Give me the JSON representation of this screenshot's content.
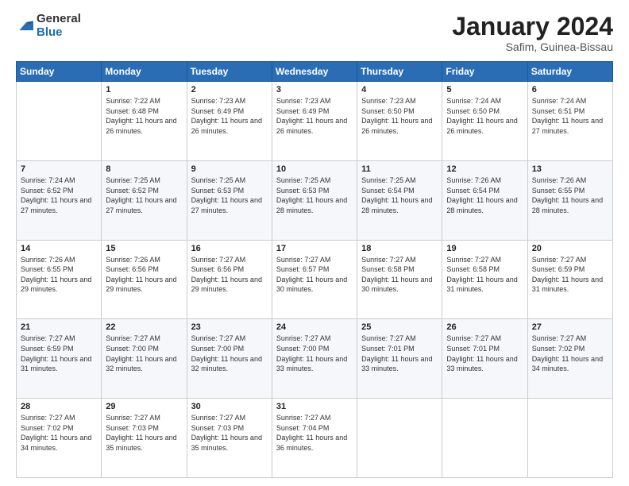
{
  "logo": {
    "general": "General",
    "blue": "Blue"
  },
  "title": {
    "month": "January 2024",
    "location": "Safim, Guinea-Bissau"
  },
  "days_header": [
    "Sunday",
    "Monday",
    "Tuesday",
    "Wednesday",
    "Thursday",
    "Friday",
    "Saturday"
  ],
  "weeks": [
    [
      {
        "day": "",
        "sunrise": "",
        "sunset": "",
        "daylight": ""
      },
      {
        "day": "1",
        "sunrise": "Sunrise: 7:22 AM",
        "sunset": "Sunset: 6:48 PM",
        "daylight": "Daylight: 11 hours and 26 minutes."
      },
      {
        "day": "2",
        "sunrise": "Sunrise: 7:23 AM",
        "sunset": "Sunset: 6:49 PM",
        "daylight": "Daylight: 11 hours and 26 minutes."
      },
      {
        "day": "3",
        "sunrise": "Sunrise: 7:23 AM",
        "sunset": "Sunset: 6:49 PM",
        "daylight": "Daylight: 11 hours and 26 minutes."
      },
      {
        "day": "4",
        "sunrise": "Sunrise: 7:23 AM",
        "sunset": "Sunset: 6:50 PM",
        "daylight": "Daylight: 11 hours and 26 minutes."
      },
      {
        "day": "5",
        "sunrise": "Sunrise: 7:24 AM",
        "sunset": "Sunset: 6:50 PM",
        "daylight": "Daylight: 11 hours and 26 minutes."
      },
      {
        "day": "6",
        "sunrise": "Sunrise: 7:24 AM",
        "sunset": "Sunset: 6:51 PM",
        "daylight": "Daylight: 11 hours and 27 minutes."
      }
    ],
    [
      {
        "day": "7",
        "sunrise": "Sunrise: 7:24 AM",
        "sunset": "Sunset: 6:52 PM",
        "daylight": "Daylight: 11 hours and 27 minutes."
      },
      {
        "day": "8",
        "sunrise": "Sunrise: 7:25 AM",
        "sunset": "Sunset: 6:52 PM",
        "daylight": "Daylight: 11 hours and 27 minutes."
      },
      {
        "day": "9",
        "sunrise": "Sunrise: 7:25 AM",
        "sunset": "Sunset: 6:53 PM",
        "daylight": "Daylight: 11 hours and 27 minutes."
      },
      {
        "day": "10",
        "sunrise": "Sunrise: 7:25 AM",
        "sunset": "Sunset: 6:53 PM",
        "daylight": "Daylight: 11 hours and 28 minutes."
      },
      {
        "day": "11",
        "sunrise": "Sunrise: 7:25 AM",
        "sunset": "Sunset: 6:54 PM",
        "daylight": "Daylight: 11 hours and 28 minutes."
      },
      {
        "day": "12",
        "sunrise": "Sunrise: 7:26 AM",
        "sunset": "Sunset: 6:54 PM",
        "daylight": "Daylight: 11 hours and 28 minutes."
      },
      {
        "day": "13",
        "sunrise": "Sunrise: 7:26 AM",
        "sunset": "Sunset: 6:55 PM",
        "daylight": "Daylight: 11 hours and 28 minutes."
      }
    ],
    [
      {
        "day": "14",
        "sunrise": "Sunrise: 7:26 AM",
        "sunset": "Sunset: 6:55 PM",
        "daylight": "Daylight: 11 hours and 29 minutes."
      },
      {
        "day": "15",
        "sunrise": "Sunrise: 7:26 AM",
        "sunset": "Sunset: 6:56 PM",
        "daylight": "Daylight: 11 hours and 29 minutes."
      },
      {
        "day": "16",
        "sunrise": "Sunrise: 7:27 AM",
        "sunset": "Sunset: 6:56 PM",
        "daylight": "Daylight: 11 hours and 29 minutes."
      },
      {
        "day": "17",
        "sunrise": "Sunrise: 7:27 AM",
        "sunset": "Sunset: 6:57 PM",
        "daylight": "Daylight: 11 hours and 30 minutes."
      },
      {
        "day": "18",
        "sunrise": "Sunrise: 7:27 AM",
        "sunset": "Sunset: 6:58 PM",
        "daylight": "Daylight: 11 hours and 30 minutes."
      },
      {
        "day": "19",
        "sunrise": "Sunrise: 7:27 AM",
        "sunset": "Sunset: 6:58 PM",
        "daylight": "Daylight: 11 hours and 31 minutes."
      },
      {
        "day": "20",
        "sunrise": "Sunrise: 7:27 AM",
        "sunset": "Sunset: 6:59 PM",
        "daylight": "Daylight: 11 hours and 31 minutes."
      }
    ],
    [
      {
        "day": "21",
        "sunrise": "Sunrise: 7:27 AM",
        "sunset": "Sunset: 6:59 PM",
        "daylight": "Daylight: 11 hours and 31 minutes."
      },
      {
        "day": "22",
        "sunrise": "Sunrise: 7:27 AM",
        "sunset": "Sunset: 7:00 PM",
        "daylight": "Daylight: 11 hours and 32 minutes."
      },
      {
        "day": "23",
        "sunrise": "Sunrise: 7:27 AM",
        "sunset": "Sunset: 7:00 PM",
        "daylight": "Daylight: 11 hours and 32 minutes."
      },
      {
        "day": "24",
        "sunrise": "Sunrise: 7:27 AM",
        "sunset": "Sunset: 7:00 PM",
        "daylight": "Daylight: 11 hours and 33 minutes."
      },
      {
        "day": "25",
        "sunrise": "Sunrise: 7:27 AM",
        "sunset": "Sunset: 7:01 PM",
        "daylight": "Daylight: 11 hours and 33 minutes."
      },
      {
        "day": "26",
        "sunrise": "Sunrise: 7:27 AM",
        "sunset": "Sunset: 7:01 PM",
        "daylight": "Daylight: 11 hours and 33 minutes."
      },
      {
        "day": "27",
        "sunrise": "Sunrise: 7:27 AM",
        "sunset": "Sunset: 7:02 PM",
        "daylight": "Daylight: 11 hours and 34 minutes."
      }
    ],
    [
      {
        "day": "28",
        "sunrise": "Sunrise: 7:27 AM",
        "sunset": "Sunset: 7:02 PM",
        "daylight": "Daylight: 11 hours and 34 minutes."
      },
      {
        "day": "29",
        "sunrise": "Sunrise: 7:27 AM",
        "sunset": "Sunset: 7:03 PM",
        "daylight": "Daylight: 11 hours and 35 minutes."
      },
      {
        "day": "30",
        "sunrise": "Sunrise: 7:27 AM",
        "sunset": "Sunset: 7:03 PM",
        "daylight": "Daylight: 11 hours and 35 minutes."
      },
      {
        "day": "31",
        "sunrise": "Sunrise: 7:27 AM",
        "sunset": "Sunset: 7:04 PM",
        "daylight": "Daylight: 11 hours and 36 minutes."
      },
      {
        "day": "",
        "sunrise": "",
        "sunset": "",
        "daylight": ""
      },
      {
        "day": "",
        "sunrise": "",
        "sunset": "",
        "daylight": ""
      },
      {
        "day": "",
        "sunrise": "",
        "sunset": "",
        "daylight": ""
      }
    ]
  ]
}
